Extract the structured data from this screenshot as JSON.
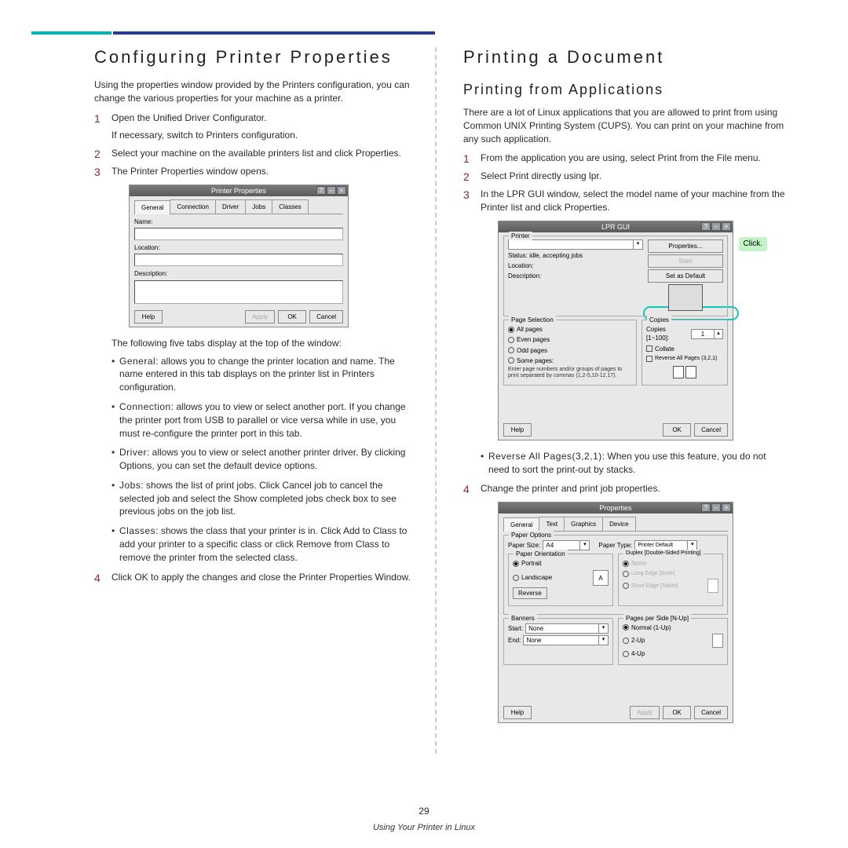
{
  "page_number": "29",
  "footer": "Using Your Printer in Linux",
  "left": {
    "h1": "Configuring Printer Properties",
    "intro": "Using the properties window provided by the Printers configuration, you can change the various properties for your machine as a printer.",
    "steps": [
      "Open the Unified Driver Configurator.",
      "Select your machine on the available printers list and click Properties.",
      "The Printer Properties window opens.",
      "Click OK to apply the changes and close the Printer Properties Window."
    ],
    "sub_if_necessary": "If necessary, switch to Printers configuration.",
    "after_screenshot_note": "The following five tabs display at the top of the window:",
    "bullets": [
      {
        "label": "General",
        "text": ": allows you to change the printer location and name. The name entered in this tab displays on the printer list in Printers configuration."
      },
      {
        "label": "Connection",
        "text": ": allows you to view or select another port. If you change the printer port from USB to parallel or vice versa while in use, you must re-configure the printer port in this tab."
      },
      {
        "label": "Driver",
        "text": ": allows you to view or select another printer driver. By clicking Options, you can set the default device options."
      },
      {
        "label": "Jobs",
        "text": ": shows the list of print jobs. Click Cancel job to cancel the selected job and select the Show completed jobs check box to see previous jobs on the job list."
      },
      {
        "label": "Classes",
        "text": ": shows the class that your printer is in. Click Add to Class to add your printer to a specific class or click Remove from Class to remove the printer from the selected class."
      }
    ],
    "dialog": {
      "title": "Printer Properties",
      "tabs": [
        "General",
        "Connection",
        "Driver",
        "Jobs",
        "Classes"
      ],
      "fields": {
        "name_label": "Name:",
        "location_label": "Location:",
        "description_label": "Description:"
      },
      "buttons": {
        "help": "Help",
        "apply": "Apply",
        "ok": "OK",
        "cancel": "Cancel"
      }
    }
  },
  "right": {
    "h1": "Printing a Document",
    "h2": "Printing from Applications",
    "intro": "There are a lot of Linux applications that you are allowed to print from using Common UNIX Printing System (CUPS). You can print on your machine from any such application.",
    "steps": [
      "From the application you are using, select Print from the File menu.",
      "Select Print directly using lpr.",
      "In the LPR GUI window, select the model name of your machine from the Printer list and click Properties.",
      "Change the printer and print job properties."
    ],
    "bullet": {
      "label": "Reverse All Pages(3,2,1)",
      "text": ": When you use this feature, you do not need to sort the print-out by stacks."
    },
    "callout": "Click.",
    "lpr": {
      "title": "LPR GUI",
      "printer_legend": "Printer",
      "btns": {
        "properties": "Properties...",
        "start": "Start",
        "set_default": "Set as Default"
      },
      "status_label": "Status: idle, accepting jobs",
      "location_label": "Location:",
      "description_label": "Description:",
      "page_selection_legend": "Page Selection",
      "all_pages": "All pages",
      "even_pages": "Even pages",
      "odd_pages": "Odd pages",
      "some_pages": "Some pages:",
      "some_hint": "Enter page numbers and/or groups of pages to print separated by commas (1,2-5,10-12,17).",
      "copies_legend": "Copies",
      "copies_label": "Copies [1~100]:",
      "copies_value": "1",
      "collate": "Collate",
      "reverse": "Reverse All Pages (3,2,1)",
      "buttons": {
        "help": "Help",
        "ok": "OK",
        "cancel": "Cancel"
      }
    },
    "props": {
      "title": "Properties",
      "tabs": [
        "General",
        "Text",
        "Graphics",
        "Device"
      ],
      "paper_options_legend": "Paper Options",
      "paper_size": "Paper Size:",
      "paper_size_val": "A4",
      "paper_type": "Paper Type:",
      "paper_type_val": "Printer Default",
      "orientation_legend": "Paper Orientation",
      "portrait": "Portrait",
      "landscape": "Landscape",
      "reverse_btn": "Reverse",
      "duplex_legend": "Duplex [Double-Sided Printing]",
      "duplex_none": "None",
      "duplex_long": "Long Edge [Book]",
      "duplex_short": "Short Edge [Tablet]",
      "banners_legend": "Banners",
      "start": "Start:",
      "end": "End:",
      "none": "None",
      "pps_legend": "Pages per Side [N-Up]",
      "nup1": "Normal (1-Up)",
      "nup2": "2-Up",
      "nup4": "4-Up",
      "buttons": {
        "help": "Help",
        "apply": "Apply",
        "ok": "OK",
        "cancel": "Cancel"
      }
    }
  }
}
